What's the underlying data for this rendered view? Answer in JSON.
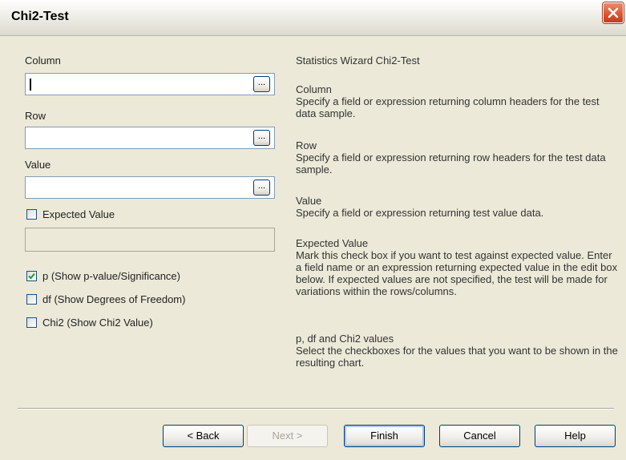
{
  "window": {
    "title": "Chi2-Test",
    "close_icon": "close-icon"
  },
  "form": {
    "column_label": "Column",
    "column_value": "",
    "row_label": "Row",
    "row_value": "",
    "value_label": "Value",
    "value_value": "",
    "browse_button_label": "...",
    "expected_value_label": "Expected Value",
    "expected_value_checked": false,
    "expected_value_value": "",
    "checkboxes": [
      {
        "label": "p (Show p-value/Significance)",
        "checked": true
      },
      {
        "label": "df (Show Degrees of Freedom)",
        "checked": false
      },
      {
        "label": "Chi2 (Show Chi2 Value)",
        "checked": false
      }
    ]
  },
  "help": {
    "heading": "Statistics Wizard Chi2-Test",
    "sections": [
      {
        "title": "Column",
        "text": "Specify a field or expression returning column headers for the test data sample."
      },
      {
        "title": "Row",
        "text": "Specify a field or expression returning row headers for the test data sample."
      },
      {
        "title": "Value",
        "text": "Specify a field or expression returning test value data."
      },
      {
        "title": "Expected Value",
        "text": "Mark this check box if you want to test against expected value. Enter a field name or an expression returning expected value in the edit box below. If expected values are not specified, the test will be made for variations within the rows/columns."
      },
      {
        "title": "p, df and Chi2 values",
        "text": "Select the checkboxes for the values that you want to be shown in the resulting chart."
      }
    ]
  },
  "buttons": {
    "back": "< Back",
    "next": "Next >",
    "finish": "Finish",
    "cancel": "Cancel",
    "help": "Help"
  },
  "colors": {
    "dialog_background": "#ece9d8",
    "close_button": "#d9542f",
    "checkmark": "#21a121",
    "field_border": "#7f9db9",
    "button_border": "#003c74"
  }
}
